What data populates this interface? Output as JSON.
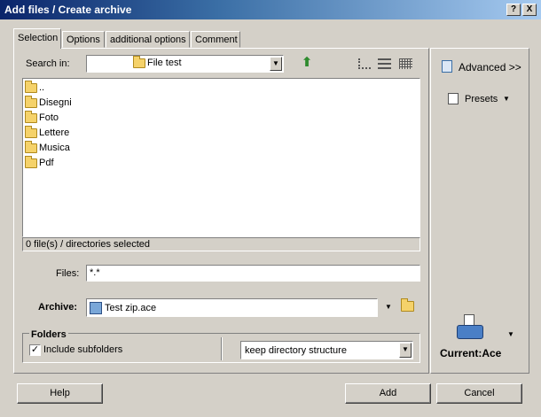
{
  "window": {
    "title": "Add files / Create archive",
    "help_glyph": "?",
    "close_glyph": "X"
  },
  "tabs": [
    {
      "label": "Selection",
      "active": true
    },
    {
      "label": "Options"
    },
    {
      "label": "additional options"
    },
    {
      "label": "Comment"
    }
  ],
  "search": {
    "label": "Search in:",
    "value": "File test"
  },
  "file_list": {
    "items": [
      {
        "label": "..",
        "icon": "folder-up-icon"
      },
      {
        "label": "Disegni",
        "icon": "folder-icon"
      },
      {
        "label": "Foto",
        "icon": "folder-icon"
      },
      {
        "label": "Lettere",
        "icon": "folder-icon"
      },
      {
        "label": "Musica",
        "icon": "folder-icon"
      },
      {
        "label": "Pdf",
        "icon": "folder-icon"
      }
    ],
    "status": "0 file(s) / directories selected"
  },
  "files": {
    "label": "Files:",
    "value": "*.*"
  },
  "archive": {
    "label": "Archive:",
    "value": "Test zip.ace"
  },
  "folders": {
    "title": "Folders",
    "include_subfolders_label": "Include subfolders",
    "include_subfolders_checked": true,
    "structure_value": "keep directory structure"
  },
  "side": {
    "advanced_label": "Advanced >>",
    "presets_label": "Presets",
    "current_label": "Current:Ace"
  },
  "buttons": {
    "help": "Help",
    "add": "Add",
    "cancel": "Cancel"
  },
  "colors": {
    "title_start": "#0a246a",
    "title_end": "#a6caf0",
    "face": "#d4d0c8"
  }
}
